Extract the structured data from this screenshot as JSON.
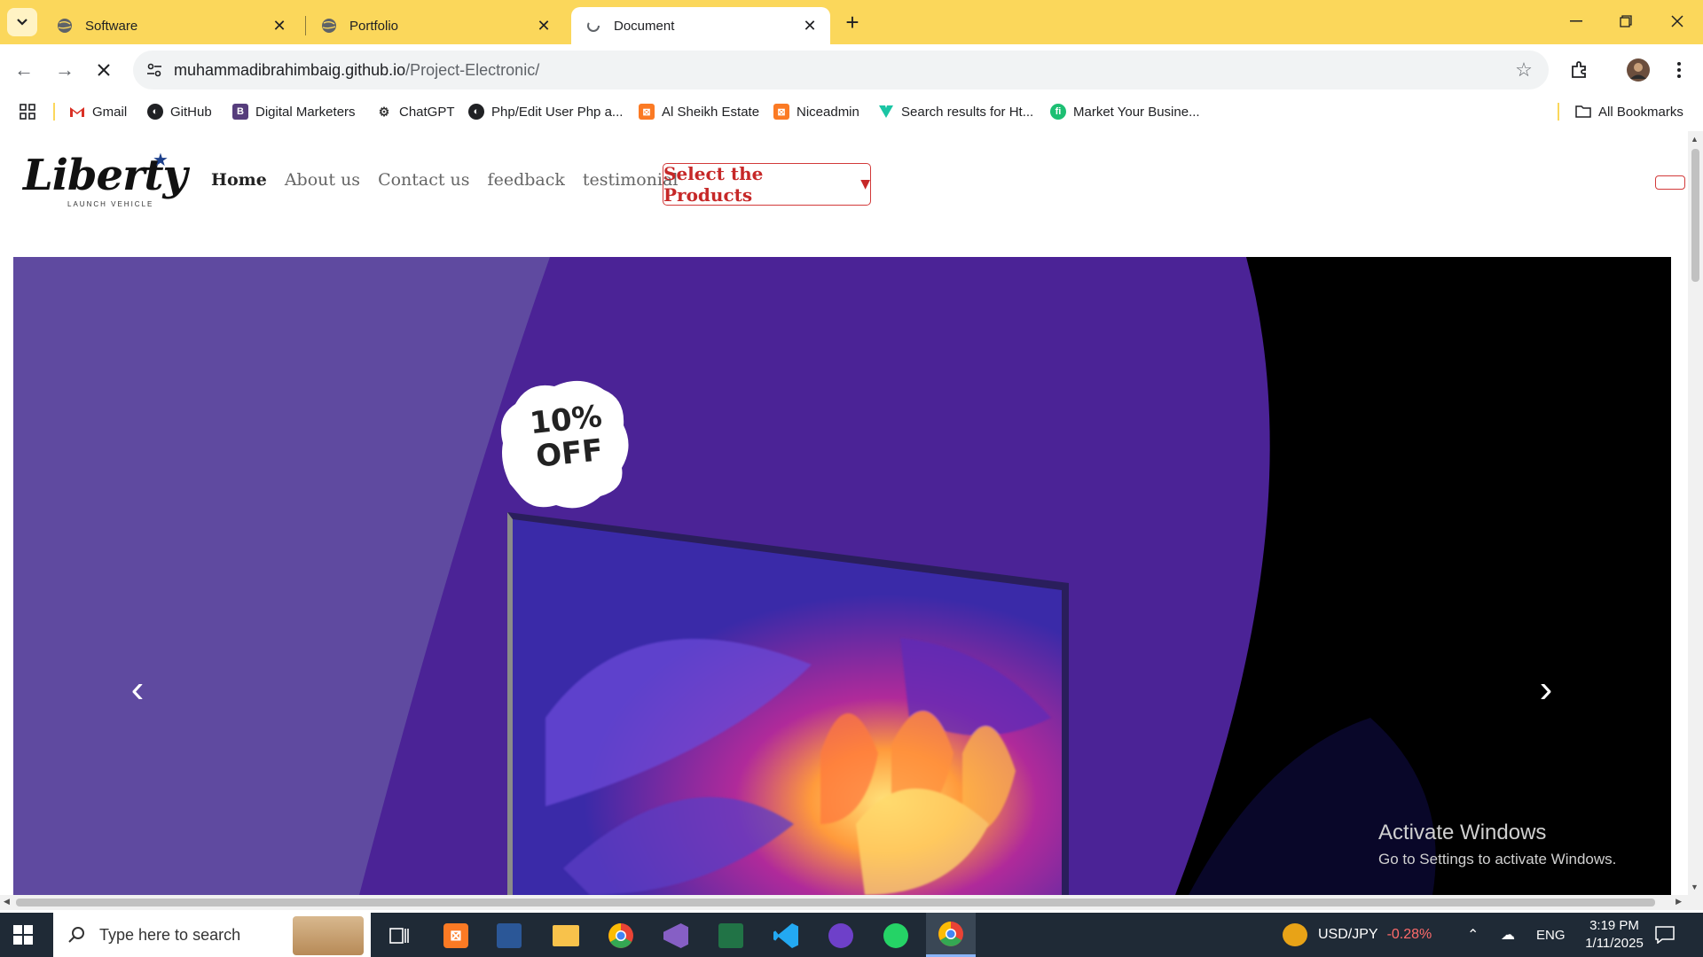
{
  "browser": {
    "tabs": [
      {
        "title": "Software",
        "active": false
      },
      {
        "title": "Portfolio",
        "active": false
      },
      {
        "title": "Document",
        "active": true
      }
    ],
    "url_host": "muhammadibrahimbaig.github.io",
    "url_path": "/Project-Electronic/",
    "bookmarks": [
      {
        "label": "Gmail",
        "icon": "gmail-icon"
      },
      {
        "label": "GitHub",
        "icon": "github-icon"
      },
      {
        "label": "Digital Marketers",
        "icon": "bootstrap-icon"
      },
      {
        "label": "ChatGPT",
        "icon": "chatgpt-icon"
      },
      {
        "label": "Php/Edit User Php a...",
        "icon": "github-icon"
      },
      {
        "label": "Al Sheikh Estate",
        "icon": "xampp-icon"
      },
      {
        "label": "Niceadmin",
        "icon": "xampp-icon"
      },
      {
        "label": "Search results for Ht...",
        "icon": "vuetify-icon"
      },
      {
        "label": "Market Your Busine...",
        "icon": "fiverr-icon"
      }
    ],
    "all_bookmarks": "All Bookmarks"
  },
  "site": {
    "logo_text": "Liberty",
    "logo_sub": "LAUNCH VEHICLE",
    "nav": [
      {
        "label": "Home",
        "active": true
      },
      {
        "label": "About us",
        "active": false
      },
      {
        "label": "Contact us",
        "active": false
      },
      {
        "label": "feedback",
        "active": false
      },
      {
        "label": "testimonial",
        "active": false
      }
    ],
    "dropdown_label": "Select the Products",
    "carousel": {
      "badge_line1": "10%",
      "badge_line2": "OFF"
    }
  },
  "watermark": {
    "line1": "Activate Windows",
    "line2": "Go to Settings to activate Windows."
  },
  "taskbar": {
    "search_placeholder": "Type here to search",
    "ticker_label": "USD/JPY",
    "ticker_change": "-0.28%",
    "language": "ENG",
    "time": "3:19 PM",
    "date": "1/11/2025"
  },
  "colors": {
    "tabbar": "#fbd75b",
    "brand_red": "#c62828",
    "ticker_negative": "#ff6b6b"
  }
}
